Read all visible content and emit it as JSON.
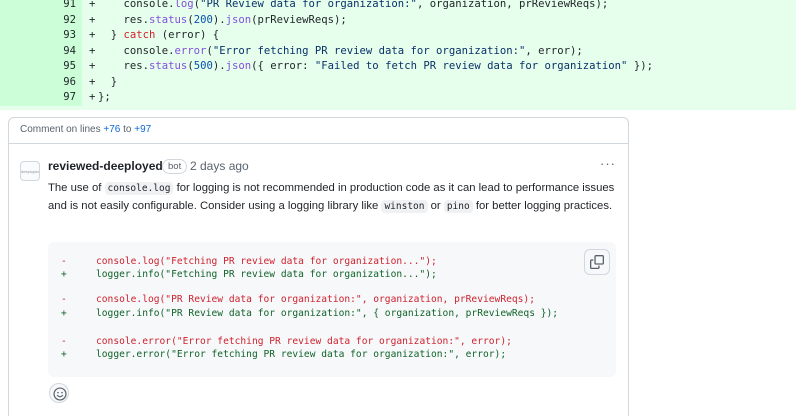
{
  "diff": {
    "lines": [
      {
        "num": "91",
        "sign": "+",
        "segments": [
          {
            "t": "    console.",
            "c": ""
          },
          {
            "t": "log",
            "c": "tk-fn"
          },
          {
            "t": "(",
            "c": ""
          },
          {
            "t": "\"PR Review data for organization:\"",
            "c": "tk-str"
          },
          {
            "t": ", organization, prReviewReqs);",
            "c": ""
          }
        ]
      },
      {
        "num": "92",
        "sign": "+",
        "segments": [
          {
            "t": "    res.",
            "c": ""
          },
          {
            "t": "status",
            "c": "tk-fn"
          },
          {
            "t": "(",
            "c": ""
          },
          {
            "t": "200",
            "c": "tk-num"
          },
          {
            "t": ").",
            "c": ""
          },
          {
            "t": "json",
            "c": "tk-fn"
          },
          {
            "t": "(prReviewReqs);",
            "c": ""
          }
        ]
      },
      {
        "num": "93",
        "sign": "+",
        "segments": [
          {
            "t": "  } ",
            "c": ""
          },
          {
            "t": "catch",
            "c": "tk-kw"
          },
          {
            "t": " (error) {",
            "c": ""
          }
        ]
      },
      {
        "num": "94",
        "sign": "+",
        "segments": [
          {
            "t": "    console.",
            "c": ""
          },
          {
            "t": "error",
            "c": "tk-fn"
          },
          {
            "t": "(",
            "c": ""
          },
          {
            "t": "\"Error fetching PR review data for organization:\"",
            "c": "tk-str"
          },
          {
            "t": ", error);",
            "c": ""
          }
        ]
      },
      {
        "num": "95",
        "sign": "+",
        "segments": [
          {
            "t": "    res.",
            "c": ""
          },
          {
            "t": "status",
            "c": "tk-fn"
          },
          {
            "t": "(",
            "c": ""
          },
          {
            "t": "500",
            "c": "tk-num"
          },
          {
            "t": ").",
            "c": ""
          },
          {
            "t": "json",
            "c": "tk-fn"
          },
          {
            "t": "({ error: ",
            "c": ""
          },
          {
            "t": "\"Failed to fetch PR review data for organization\"",
            "c": "tk-str"
          },
          {
            "t": " });",
            "c": ""
          }
        ]
      },
      {
        "num": "96",
        "sign": "+",
        "segments": [
          {
            "t": "  }",
            "c": ""
          }
        ]
      },
      {
        "num": "97",
        "sign": "+",
        "segments": [
          {
            "t": "};",
            "c": ""
          }
        ]
      }
    ]
  },
  "comment": {
    "header_prefix": "Comment on lines ",
    "range_start": "+76",
    "header_mid": " to ",
    "range_end": "+97",
    "avatar_text": "deeployed",
    "author": "reviewed-deeployed",
    "badge": "bot",
    "time": "2 days ago",
    "more_label": "···",
    "body": [
      {
        "t": "The use of ",
        "code": false
      },
      {
        "t": "console.log",
        "code": true
      },
      {
        "t": " for logging is not recommended in production code as it can lead to performance issues and is not easily configurable. Consider using a logging library like ",
        "code": false
      },
      {
        "t": "winston",
        "code": true
      },
      {
        "t": " or ",
        "code": false
      },
      {
        "t": "pino",
        "code": true
      },
      {
        "t": " for better logging practices.",
        "code": false
      }
    ],
    "suggestion": [
      {
        "sign": "-",
        "kind": "del",
        "code": "console.log(\"Fetching PR review data for organization...\");"
      },
      {
        "sign": "+",
        "kind": "add",
        "code": "logger.info(\"Fetching PR review data for organization...\");"
      },
      {
        "sign": "-",
        "kind": "del",
        "code": "console.log(\"PR Review data for organization:\", organization, prReviewReqs);"
      },
      {
        "sign": "+",
        "kind": "add",
        "code": "logger.info(\"PR Review data for organization:\", { organization, prReviewReqs });"
      },
      {
        "sign": "-",
        "kind": "del",
        "code": "console.error(\"Error fetching PR review data for organization:\", error);"
      },
      {
        "sign": "+",
        "kind": "add",
        "code": "logger.error(\"Error fetching PR review data for organization:\", error);"
      }
    ]
  },
  "colors": {
    "diff_bg": "#e6ffec",
    "diff_gutter": "#ccffd8",
    "deletion": "#cf222e",
    "addition": "#116329",
    "link": "#0969da"
  },
  "icons": [
    "copy-icon",
    "smiley-icon",
    "kebab-menu-icon"
  ]
}
